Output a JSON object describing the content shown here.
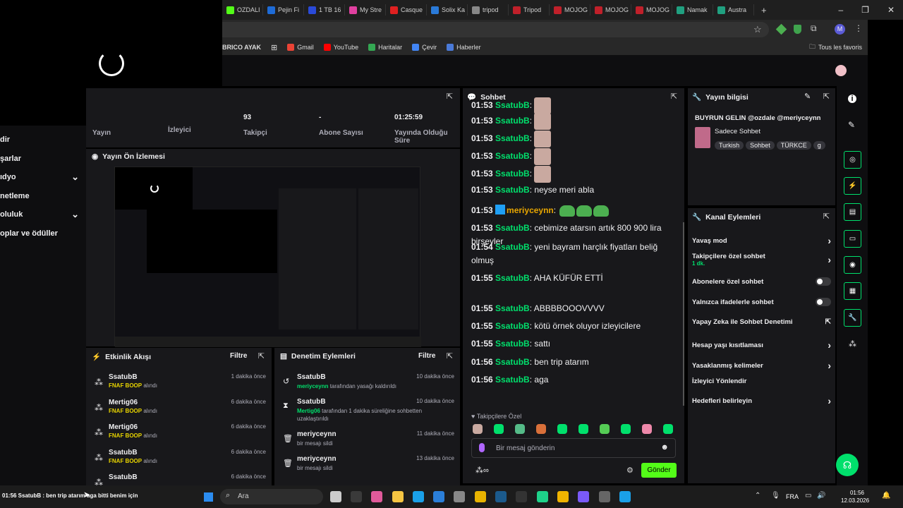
{
  "browser": {
    "tabs": [
      {
        "label": "OZDALI",
        "color": "#53fc18"
      },
      {
        "label": "Pejin Fi",
        "color": "#1e6bd6"
      },
      {
        "label": "1 TB 16",
        "color": "#2a4ad8"
      },
      {
        "label": "My Stre",
        "color": "#e040a0"
      },
      {
        "label": "Casque",
        "color": "#e02020"
      },
      {
        "label": "Solix Ka",
        "color": "#2a7ad8"
      },
      {
        "label": "tripod",
        "color": "#888888"
      },
      {
        "label": "Tripod",
        "color": "#c0202a"
      },
      {
        "label": "MOJOG",
        "color": "#c0202a"
      },
      {
        "label": "MOJOG",
        "color": "#c0202a"
      },
      {
        "label": "MOJOG",
        "color": "#c0202a"
      },
      {
        "label": "Namak",
        "color": "#20a080"
      },
      {
        "label": "Austra",
        "color": "#20a080"
      }
    ],
    "new_tab": "+",
    "window_buttons": [
      "–",
      "❐",
      "✕"
    ],
    "bookmarks_lead": "BRICO AYAK",
    "bookmarks": [
      {
        "label": "Gmail",
        "color": "#ea4335"
      },
      {
        "label": "YouTube",
        "color": "#ff0000"
      },
      {
        "label": "Haritalar",
        "color": "#34a853"
      },
      {
        "label": "Çevir",
        "color": "#4285f4"
      },
      {
        "label": "Haberler",
        "color": "#4a7ad8"
      }
    ],
    "all_bookmarks": "Tous les favoris",
    "profile_initial": "M"
  },
  "leftnav": {
    "items": [
      {
        "label": "dir",
        "chevron": ""
      },
      {
        "label": "şarlar",
        "chevron": ""
      },
      {
        "label": "ıdyo",
        "chevron": "⌄"
      },
      {
        "label": "netleme",
        "chevron": ""
      },
      {
        "label": "oluluk",
        "chevron": "⌄"
      },
      {
        "label": "oplar ve ödüller",
        "chevron": ""
      }
    ]
  },
  "stats": {
    "items": [
      {
        "value": "",
        "label": "Yayın"
      },
      {
        "value": "",
        "label": "İzleyici"
      },
      {
        "value": "93",
        "label": "Takipçi"
      },
      {
        "value": "-",
        "label": "Abone Sayısı"
      },
      {
        "value": "01:25:59",
        "label": "Yayında Olduğu Süre"
      }
    ]
  },
  "preview": {
    "title": "Yayın Ön İzlemesi"
  },
  "activity": {
    "title": "Etkinlik Akışı",
    "filter": "Filtre",
    "items": [
      {
        "name": "SsatubB",
        "reward": "FNAF BOOP",
        "suffix": "alındı",
        "time": "1 dakika önce"
      },
      {
        "name": "Mertig06",
        "reward": "FNAF BOOP",
        "suffix": "alındı",
        "time": "6 dakika önce"
      },
      {
        "name": "Mertig06",
        "reward": "FNAF BOOP",
        "suffix": "alındı",
        "time": "6 dakika önce"
      },
      {
        "name": "SsatubB",
        "reward": "FNAF BOOP",
        "suffix": "alındı",
        "time": "6 dakika önce"
      },
      {
        "name": "SsatubB",
        "reward": "",
        "suffix": "",
        "time": "6 dakika önce"
      }
    ]
  },
  "moderation": {
    "title": "Denetim Eylemleri",
    "filter": "Filtre",
    "items": [
      {
        "icon": "↺",
        "name": "SsatubB",
        "actor": "meriyceynn",
        "text": "tarafından yasağı kaldırıldı",
        "time": "10 dakika önce"
      },
      {
        "icon": "⧗",
        "name": "SsatubB",
        "actor": "Mertig06",
        "text": "tarafından 1 dakika süreliğine sohbetten uzaklaştırıldı",
        "time": "10 dakika önce"
      },
      {
        "icon": "🗑",
        "name": "meriyceynn",
        "actor": "",
        "text": "bir mesajı sildi",
        "time": "11 dakika önce"
      },
      {
        "icon": "🗑",
        "name": "meriyceynn",
        "actor": "",
        "text": "bir mesajı sildi",
        "time": "13 dakika önce"
      }
    ]
  },
  "chat": {
    "title": "Sohbet",
    "lines": [
      {
        "time": "01:53",
        "user": "SsatubB",
        "msg": "",
        "emote": true
      },
      {
        "time": "01:53",
        "user": "SsatubB",
        "msg": "",
        "emote": true
      },
      {
        "time": "01:53",
        "user": "SsatubB",
        "msg": "",
        "emote": true
      },
      {
        "time": "01:53",
        "user": "SsatubB",
        "msg": "",
        "emote": true
      },
      {
        "time": "01:53",
        "user": "SsatubB",
        "msg": "",
        "emote": true
      },
      {
        "time": "01:53",
        "user": "SsatubB",
        "msg": "neyse meri abla"
      },
      {
        "time": "01:53",
        "user": "meriyceynn",
        "msg": "",
        "pepe": true,
        "mod": true
      },
      {
        "time": "01:53",
        "user": "SsatubB",
        "msg": "cebimize atarsın artık 800 900 lira birşeyler"
      },
      {
        "time": "01:54",
        "user": "SsatubB",
        "msg": "yeni bayram harçlık fiyatları beliğ olmuş"
      },
      {
        "time": "01:55",
        "user": "SsatubB",
        "msg": "AHA KÜFÜR ETTİ"
      },
      {
        "time": "01:55",
        "user": "SsatubB",
        "msg": "ABBBBOOOVVVV"
      },
      {
        "time": "01:55",
        "user": "SsatubB",
        "msg": "kötü örnek oluyor izleyicilere"
      },
      {
        "time": "01:55",
        "user": "SsatubB",
        "msg": "sattı"
      },
      {
        "time": "01:56",
        "user": "SsatubB",
        "msg": "ben trip atarım"
      },
      {
        "time": "01:56",
        "user": "SsatubB",
        "msg": "aga"
      }
    ],
    "followers_only": "Takipçilere Özel",
    "input_placeholder": "Bir mesaj gönderin",
    "send": "Gönder"
  },
  "stream_info": {
    "title": "Yayın bilgisi",
    "stream_title": "BUYRUN GELIN @ozdale @meriyceynn",
    "category": "Sadece Sohbet",
    "tags": [
      "Turkish",
      "Sohbet",
      "TÜRKCE",
      "g"
    ]
  },
  "channel_actions": {
    "title": "Kanal Eylemleri",
    "items": [
      {
        "label": "Yavaş mod",
        "control": "chevron",
        "sub": ""
      },
      {
        "label": "Takipçilere özel sohbet",
        "control": "chevron",
        "sub": "1 dk."
      },
      {
        "label": "Abonelere özel sohbet",
        "control": "toggle",
        "sub": ""
      },
      {
        "label": "Yalnızca ifadelerle sohbet",
        "control": "toggle",
        "sub": ""
      },
      {
        "label": "Yapay Zeka ile Sohbet Denetimi",
        "control": "external",
        "sub": ""
      },
      {
        "label": "Hesap yaşı kısıtlaması",
        "control": "chevron",
        "sub": ""
      },
      {
        "label": "Yasaklanmış kelimeler",
        "control": "chevron",
        "sub": ""
      },
      {
        "label": "İzleyici Yönlendir",
        "control": "",
        "sub": ""
      },
      {
        "label": "Hedefleri belirleyin",
        "control": "chevron",
        "sub": ""
      }
    ]
  },
  "taskbar": {
    "notification": "01:56 SsatubB : ben trip atarım aga bitti benim için",
    "search": "Ara",
    "lang": "FRA",
    "time": "01:56",
    "date": "12.03.2026"
  },
  "colors": {
    "accent": "#00e06c",
    "panel": "#18181b",
    "bg": "#0e0e10"
  }
}
